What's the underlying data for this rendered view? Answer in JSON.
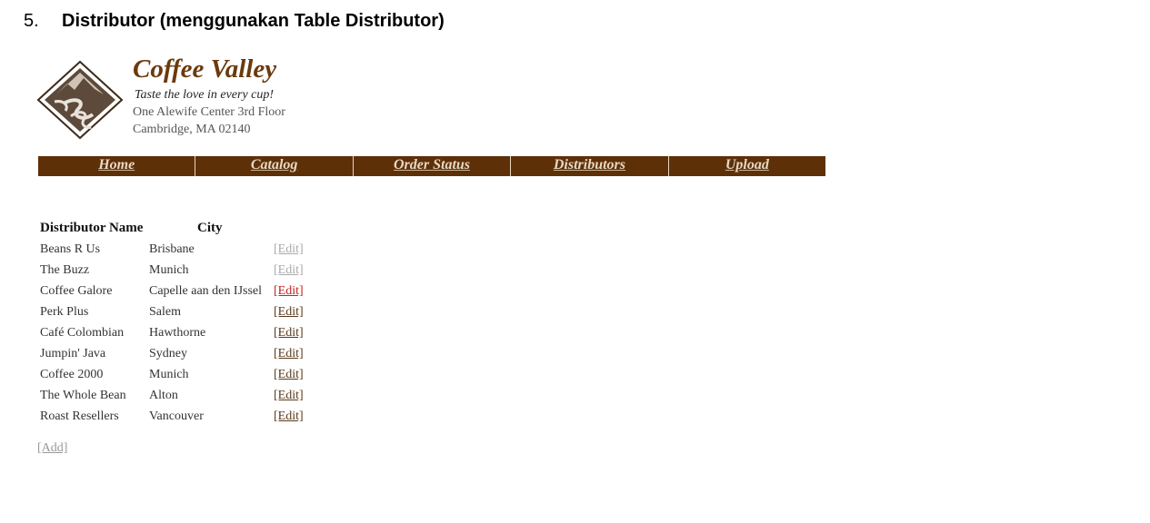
{
  "doc": {
    "number": "5.",
    "title": "Distributor (menggunakan Table Distributor)"
  },
  "site": {
    "name": "Coffee Valley",
    "tagline": "Taste the love in every cup!",
    "address_line1": "One Alewife Center 3rd Floor",
    "address_line2": "Cambridge,  MA 02140",
    "brand_color": "#6b3a0d",
    "nav_color": "#5e3008"
  },
  "nav": {
    "items": [
      "Home",
      "Catalog",
      "Order Status",
      "Distributors",
      "Upload"
    ]
  },
  "table": {
    "headers": {
      "name": "Distributor Name",
      "city": "City"
    },
    "edit_label": "[Edit]",
    "rows": [
      {
        "name": "Beans R Us",
        "city": "Brisbane",
        "edit": "[Edit]",
        "state": "faded"
      },
      {
        "name": "The Buzz",
        "city": "Munich",
        "edit": "[Edit]",
        "state": "faded"
      },
      {
        "name": "Coffee Galore",
        "city": "Capelle aan den IJssel",
        "edit": "[Edit]",
        "state": "hover"
      },
      {
        "name": "Perk Plus",
        "city": "Salem",
        "edit": "[Edit]",
        "state": "normal"
      },
      {
        "name": "Café Colombian",
        "city": "Hawthorne",
        "edit": "[Edit]",
        "state": "normal"
      },
      {
        "name": "Jumpin' Java",
        "city": "Sydney",
        "edit": "[Edit]",
        "state": "normal"
      },
      {
        "name": "Coffee 2000",
        "city": "Munich",
        "edit": "[Edit]",
        "state": "normal"
      },
      {
        "name": "The Whole Bean",
        "city": "Alton",
        "edit": "[Edit]",
        "state": "normal"
      },
      {
        "name": "Roast Resellers",
        "city": "Vancouver",
        "edit": "[Edit]",
        "state": "normal"
      }
    ]
  },
  "add_label": "[Add]"
}
